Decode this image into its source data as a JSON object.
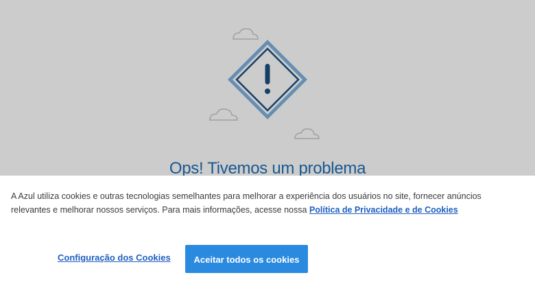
{
  "error": {
    "title": "Ops! Tivemos um problema"
  },
  "cookie_banner": {
    "text": "A Azul utiliza cookies e outras tecnologias semelhantes para melhorar a experiência dos usuários no site, fornecer anúncios relevantes e melhorar nossos serviços. Para mais informações, acesse nossa",
    "policy_link": "Política de Privacidade e de Cookies",
    "config_button": "Configuração dos Cookies",
    "accept_button": "Aceitar todos os cookies"
  },
  "colors": {
    "accent_blue": "#2a8ae0",
    "link_blue": "#1f5fbf",
    "title_blue": "#1f6fb5",
    "overlay": "rgba(0,0,0,0.20)"
  },
  "icons": [
    "cloud-icon",
    "warning-diamond-icon",
    "exclamation-icon"
  ]
}
